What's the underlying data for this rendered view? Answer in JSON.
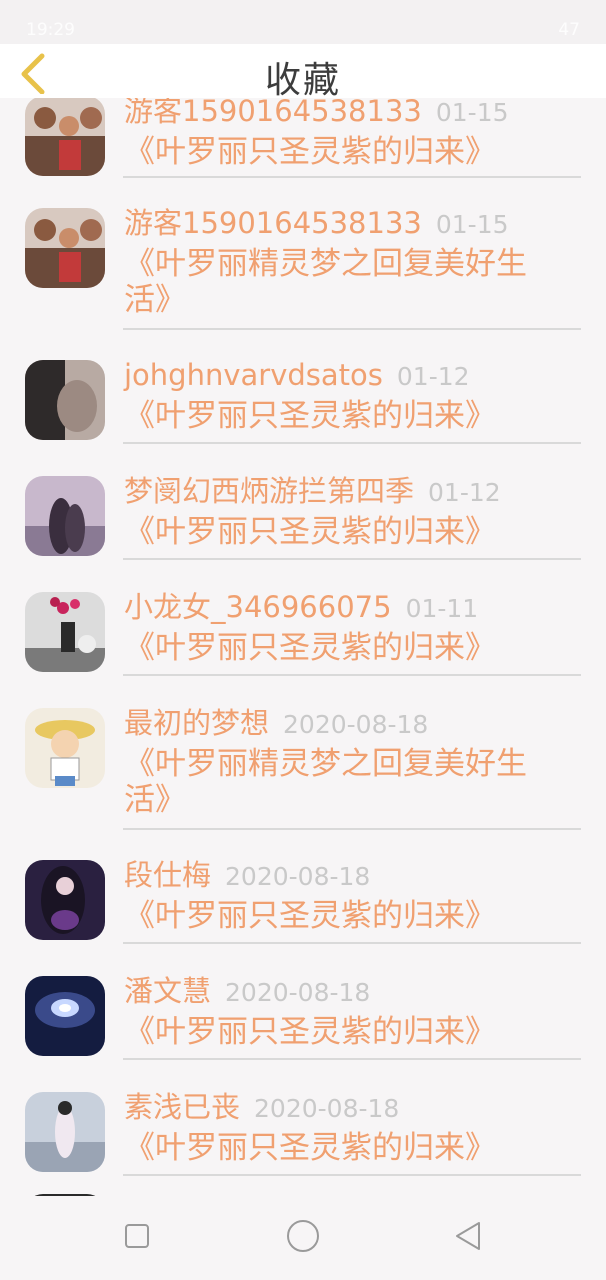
{
  "status_bar": {
    "time": "19:29",
    "battery": "47"
  },
  "header": {
    "title": "收藏"
  },
  "items": [
    {
      "user": "游客1590164538133",
      "date": "01-15",
      "book": "《叶罗丽只圣灵紫的归来》"
    },
    {
      "user": "游客1590164538133",
      "date": "01-15",
      "book": "《叶罗丽精灵梦之回复美好生活》"
    },
    {
      "user": "johghnvarvdsatos",
      "date": "01-12",
      "book": "《叶罗丽只圣灵紫的归来》"
    },
    {
      "user": "梦阌幻西炳游拦第四季",
      "date": "01-12",
      "book": "《叶罗丽只圣灵紫的归来》"
    },
    {
      "user": "小龙女_346966075",
      "date": "01-11",
      "book": "《叶罗丽只圣灵紫的归来》"
    },
    {
      "user": "最初的梦想",
      "date": "2020-08-18",
      "book": "《叶罗丽精灵梦之回复美好生活》"
    },
    {
      "user": "段仕梅",
      "date": "2020-08-18",
      "book": "《叶罗丽只圣灵紫的归来》"
    },
    {
      "user": "潘文慧",
      "date": "2020-08-18",
      "book": "《叶罗丽只圣灵紫的归来》"
    },
    {
      "user": "素浅已丧",
      "date": "2020-08-18",
      "book": "《叶罗丽只圣灵紫的归来》"
    }
  ],
  "colors": {
    "accent": "#f0a070",
    "date": "#c9c9c9",
    "back_icon": "#e8c24a"
  },
  "icons": {
    "back": "chevron-left-icon",
    "nav_recent": "square-icon",
    "nav_home": "circle-icon",
    "nav_back": "triangle-icon"
  }
}
